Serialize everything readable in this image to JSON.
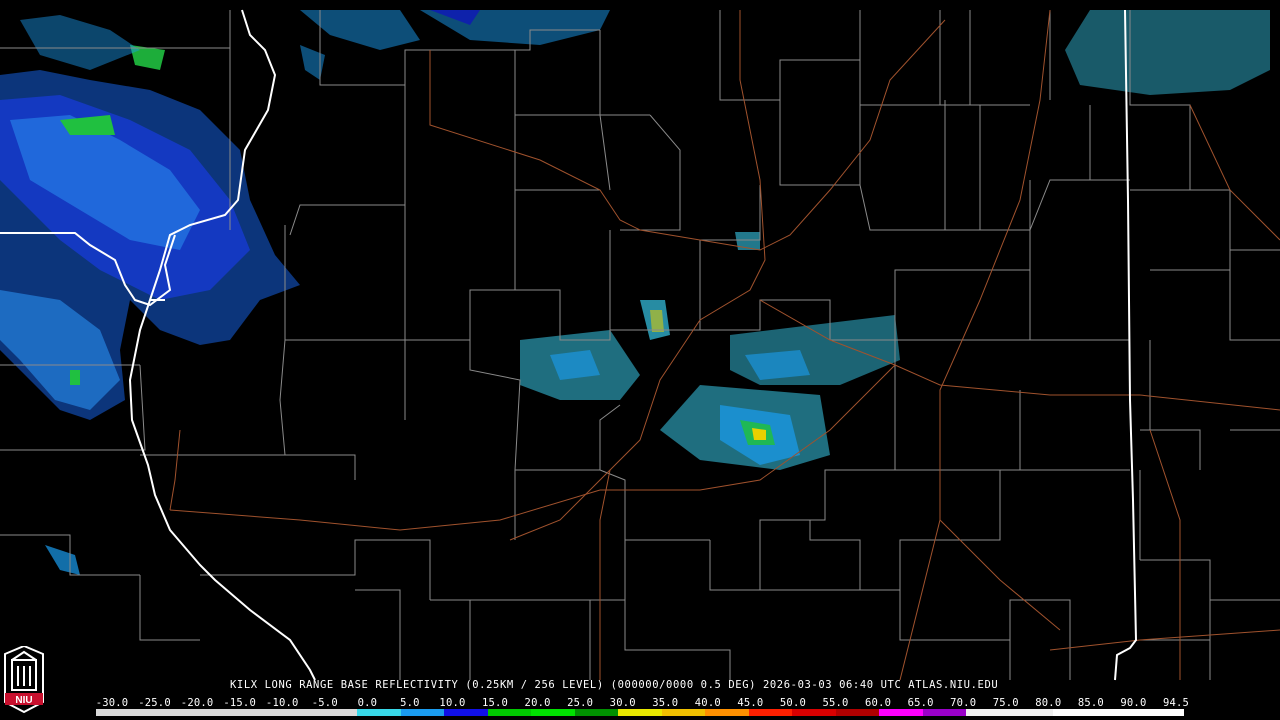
{
  "product": {
    "caption": "KILX LONG RANGE BASE REFLECTIVITY (0.25KM / 256 LEVEL) (000000/0000 0.5 DEG) 2026-03-03 06:40 UTC  ATLAS.NIU.EDU"
  },
  "scale": {
    "labels": [
      "-30.0",
      "-25.0",
      "-20.0",
      "-15.0",
      "-10.0",
      "-5.0",
      "0.0",
      "5.0",
      "10.0",
      "15.0",
      "20.0",
      "25.0",
      "30.0",
      "35.0",
      "40.0",
      "45.0",
      "50.0",
      "55.0",
      "60.0",
      "65.0",
      "70.0",
      "75.0",
      "80.0",
      "85.0",
      "90.0",
      "94.5"
    ],
    "colors": [
      "#d9d9d9",
      "#d9d9d9",
      "#d9d9d9",
      "#d9d9d9",
      "#d9d9d9",
      "#d9d9d9",
      "#38d8e8",
      "#1a9cf0",
      "#1010e8",
      "#00c800",
      "#00e000",
      "#009000",
      "#e8e800",
      "#f0c000",
      "#ff9000",
      "#ff2000",
      "#d80000",
      "#b00000",
      "#ff00ff",
      "#9a00c8",
      "#f0f0f0",
      "#f0f0f0",
      "#ffffff",
      "#ffffff",
      "#ffffff"
    ]
  },
  "logo": {
    "text": "NIU"
  },
  "map": {
    "radar_site": "KILX",
    "boundary_color": "#8a8a8a",
    "state_line_color": "#ffffff",
    "highway_color": "#a0522d"
  }
}
